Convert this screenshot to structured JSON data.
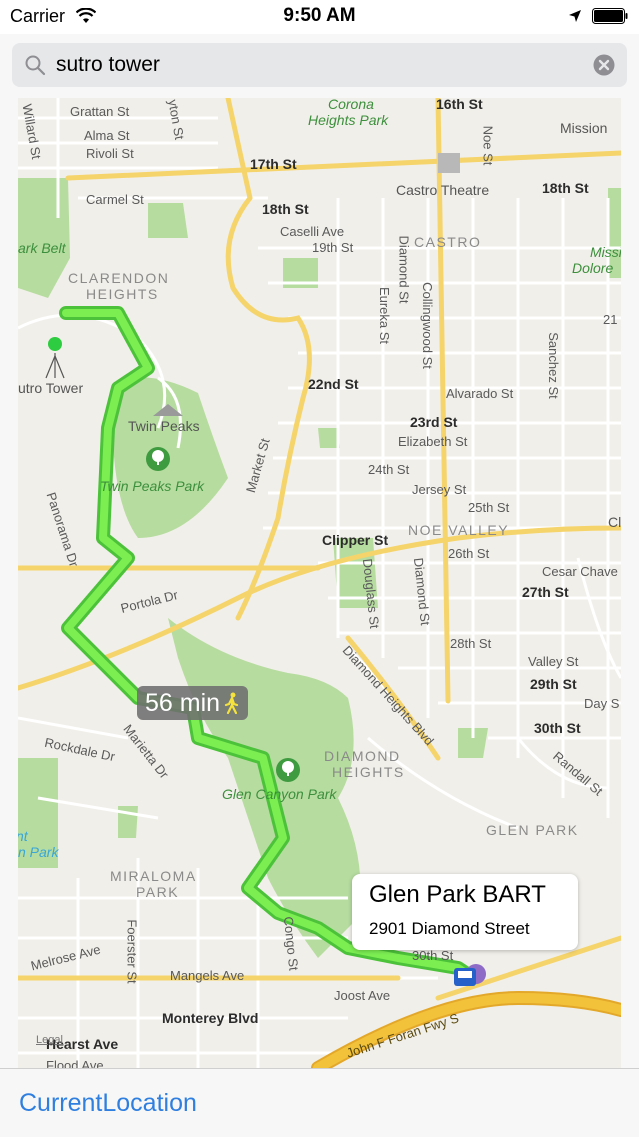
{
  "status_bar": {
    "carrier": "Carrier",
    "time": "9:50 AM"
  },
  "search": {
    "value": "sutro tower"
  },
  "map": {
    "streets": {
      "grattan": "Grattan St",
      "alma": "Alma St",
      "rivoli": "Rivoli St",
      "carmel": "Carmel St",
      "willard": "Willard St",
      "clayton": "yton St",
      "st17": "17th St",
      "st16": "16th St",
      "st18a": "18th St",
      "st18b": "18th St",
      "caselli": "Caselli Ave",
      "st19": "19th St",
      "diamond1": "Diamond St",
      "eureka": "Eureka St",
      "collingwood": "Collingwood St",
      "noe": "Noe St",
      "sanchez": "Sanchez St",
      "st22": "22nd St",
      "alvarado": "Alvarado St",
      "st23": "23rd St",
      "elizabeth": "Elizabeth St",
      "st24": "24th St",
      "jersey": "Jersey St",
      "st25": "25th St",
      "market": "Market St",
      "clipper": "Clipper St",
      "st26": "26th St",
      "cesar": "Cesar Chave",
      "st27": "27th St",
      "panorama": "Panorama Dr",
      "portola": "Portola Dr",
      "douglass": "Douglass St",
      "diamond2": "Diamond St",
      "st28": "28th St",
      "diamond_heights": "Diamond Heights Blvd",
      "valley": "Valley St",
      "st29": "29th St",
      "day": "Day S",
      "st30": "30th St",
      "randall": "Randall St",
      "rockdale": "Rockdale Dr",
      "marietta": "Marietta Dr",
      "melrose": "Melrose Ave",
      "foerster": "Foerster St",
      "mangels": "Mangels Ave",
      "congo": "Congo St",
      "joost": "Joost Ave",
      "monterey": "Monterey Blvd",
      "hearst": "Hearst Ave",
      "flood": "Flood Ave",
      "foran": "John F Foran Fwy S",
      "st21": "21",
      "st30b": "30th St"
    },
    "neighborhoods": {
      "clarendon": "CLARENDON",
      "heights": "HEIGHTS",
      "castro": "CASTRO",
      "noe_valley": "NOE VALLEY",
      "diamond": "DIAMOND",
      "diamond_heights": "HEIGHTS",
      "glen_park": "GLEN PARK",
      "miraloma": "MIRALOMA",
      "miraloma_park": "PARK"
    },
    "parks": {
      "corona1": "Corona",
      "corona2": "Heights Park",
      "park_belt": "ark Belt",
      "twin_peaks_park": "Twin Peaks Park",
      "glen_canyon": "Glen Canyon Park",
      "mission1": "Missi",
      "mission2": "Dolore",
      "nt": "nt",
      "n_park": "n Park"
    },
    "pois": {
      "sutro": "utro Tower",
      "twin_peaks": "Twin Peaks",
      "castro_theatre": "Castro Theatre",
      "mission": "Mission",
      "cl": "Cl"
    },
    "walk_time": "56 min",
    "legal": "Legal"
  },
  "callout": {
    "title": "Glen Park BART",
    "subtitle": "2901 Diamond Street"
  },
  "toolbar": {
    "current_location": "CurrentLocation"
  },
  "colors": {
    "route": "#6de23c",
    "park": "#b6dca0",
    "major_road": "#f5d46b",
    "freeway": "#f2c23a",
    "link": "#2f7fe0"
  }
}
